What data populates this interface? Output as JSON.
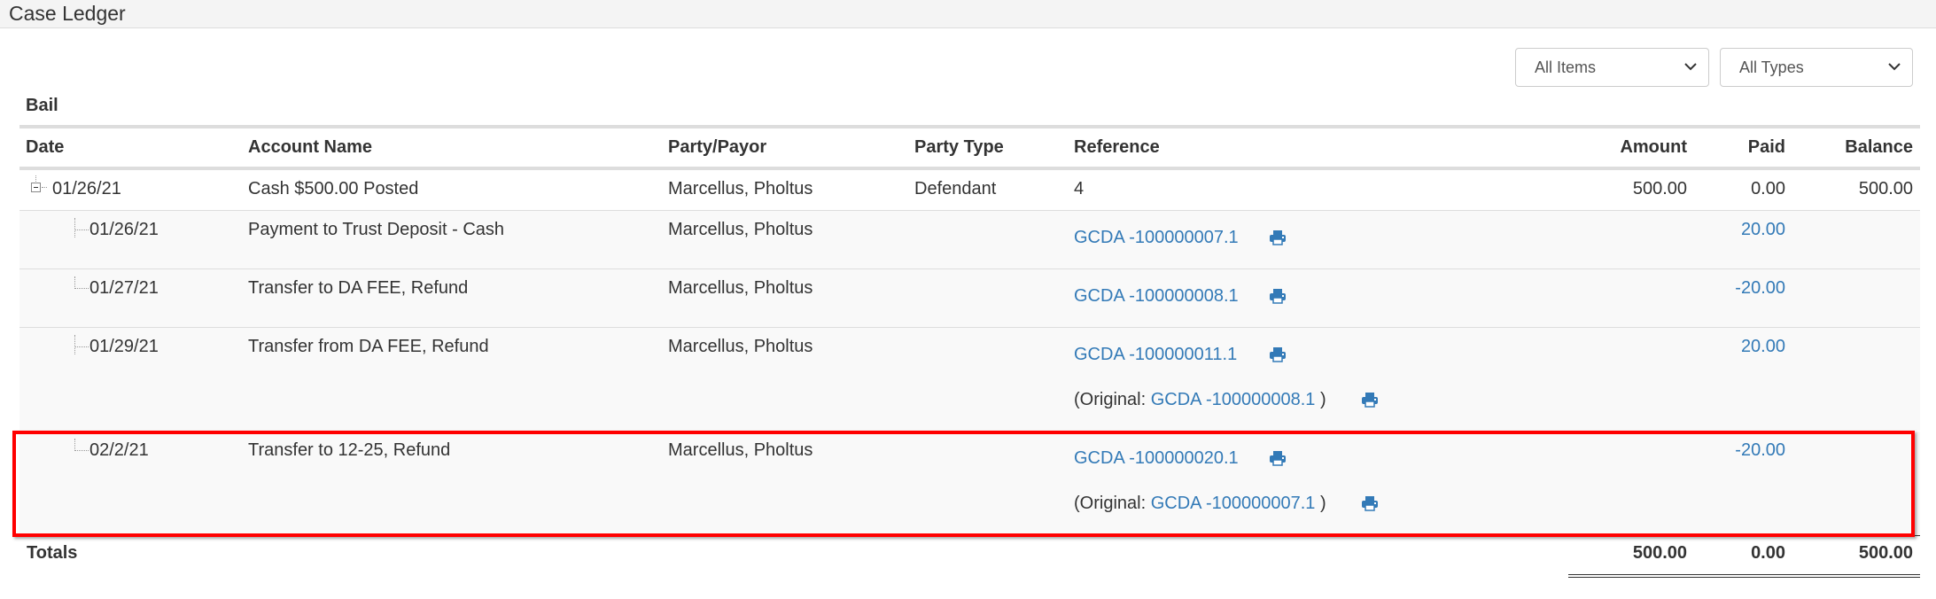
{
  "header": {
    "title": "Case Ledger"
  },
  "filters": {
    "items_select": {
      "value": "All Items",
      "icon": "chevron-down-icon"
    },
    "types_select": {
      "value": "All Types",
      "icon": "chevron-down-icon"
    }
  },
  "section": {
    "label": "Bail"
  },
  "table": {
    "columns": [
      "Date",
      "Account Name",
      "Party/Payor",
      "Party Type",
      "Reference",
      "Amount",
      "Paid",
      "Balance"
    ],
    "parent_row": {
      "date": "01/26/21",
      "account_name": "Cash $500.00 Posted",
      "party": "Marcellus, Pholtus",
      "party_type": "Defendant",
      "reference": "4",
      "amount": "500.00",
      "paid": "0.00",
      "balance": "500.00",
      "expander_icon": "collapse-minus-icon"
    },
    "child_rows": [
      {
        "date": "01/26/21",
        "account_name": "Payment to Trust Deposit - Cash",
        "party": "Marcellus, Pholtus",
        "reference": "GCDA -100000007.1",
        "paid": "20.00"
      },
      {
        "date": "01/27/21",
        "account_name": "Transfer to DA FEE, Refund",
        "party": "Marcellus, Pholtus",
        "reference": "GCDA -100000008.1",
        "paid": "-20.00"
      },
      {
        "date": "01/29/21",
        "account_name": "Transfer from DA FEE, Refund",
        "party": "Marcellus, Pholtus",
        "reference": "GCDA -100000011.1",
        "original_label": "(Original: ",
        "original_ref": "GCDA -100000008.1",
        "original_close": " )",
        "paid": "20.00"
      },
      {
        "date": "02/2/21",
        "account_name": "Transfer to 12-25, Refund",
        "party": "Marcellus, Pholtus",
        "reference": "GCDA -100000020.1",
        "original_label": "(Original: ",
        "original_ref": "GCDA -100000007.1",
        "original_close": " )",
        "paid": "-20.00",
        "highlighted": true
      }
    ],
    "totals": {
      "label": "Totals",
      "amount": "500.00",
      "paid": "0.00",
      "balance": "500.00"
    }
  },
  "colors": {
    "link": "#337ab7",
    "highlight": "#ff0000",
    "text": "#333333",
    "row_alt": "#f9f9f9"
  }
}
